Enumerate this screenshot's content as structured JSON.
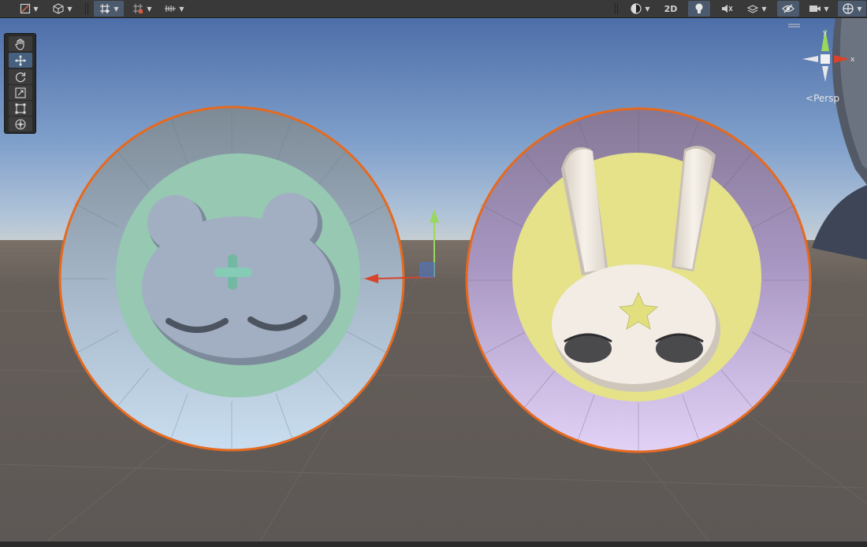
{
  "toolbar": {
    "left_buttons": [
      "draw-mode-icon",
      "gizmo-cube-icon",
      "grid-snap-icon",
      "increment-snap-icon",
      "ruler-icon"
    ],
    "right_buttons": [
      "shading-mode-icon",
      "2d-toggle",
      "lighting-icon",
      "audio-mute-icon",
      "effects-icon",
      "visibility-icon",
      "camera-icon",
      "gizmos-icon"
    ],
    "mode_2d_label": "2D"
  },
  "tools": [
    "view-tool",
    "move-tool",
    "rotate-tool",
    "scale-tool",
    "rect-tool",
    "transform-tool"
  ],
  "active_tool": "move-tool",
  "orientation_gizmo": {
    "projection_label": "Persp",
    "axis_y": "y",
    "axis_x": "x"
  },
  "scene_objects": [
    {
      "name": "bear-badge",
      "selected": true
    },
    {
      "name": "bunny-badge",
      "selected": true
    }
  ],
  "colors": {
    "sky_top": "#5676ad",
    "horizon": "#bdc7cb",
    "ground": "#5f5a57",
    "selection_outline": "#e56a1f",
    "bear_inner_disk": "#96c8b2",
    "bear_face": "#9aa7ba",
    "bunny_inner_disk": "#e5e28a",
    "bunny_face": "#f2ece4",
    "axis_x": "#d8442b",
    "axis_y": "#9ad75e",
    "axis_z": "#4c76c8"
  }
}
